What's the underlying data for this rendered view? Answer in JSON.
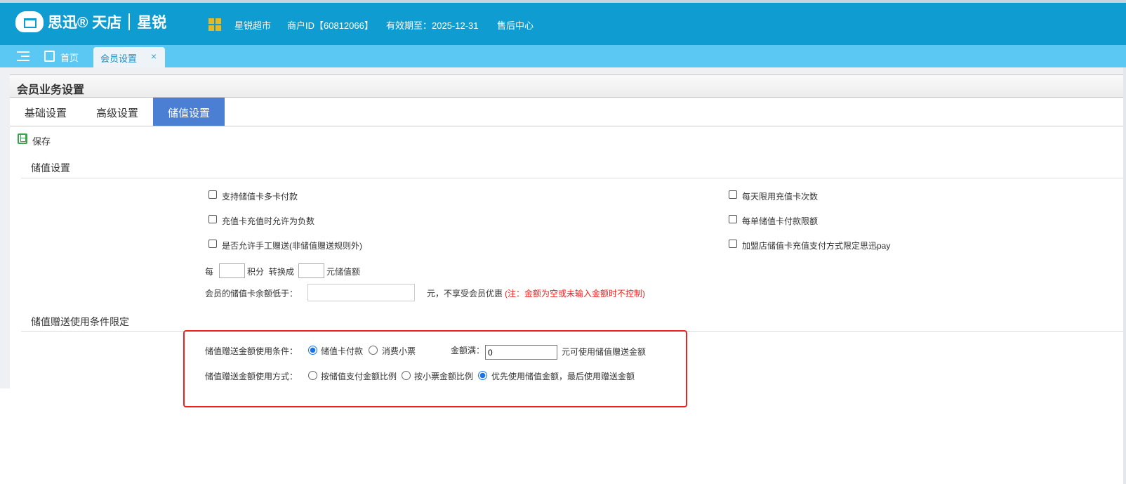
{
  "header": {
    "logo_text": "思迅® 天店",
    "product": "星锐",
    "store": "星锐超市",
    "merchant_id": "商户ID【60812066】",
    "expiry": "有效期至：2025-12-31",
    "support": "售后中心"
  },
  "tabs": {
    "home": "首页",
    "active": "会员设置",
    "close": "×"
  },
  "panel": {
    "title": "会员业务设置",
    "tabs": [
      "基础设置",
      "高级设置",
      "储值设置"
    ],
    "active_tab": "储值设置",
    "save": "保存"
  },
  "stored_value": {
    "title": "储值设置",
    "checkboxes_left": [
      {
        "label": "支持储值卡多卡付款",
        "checked": false
      },
      {
        "label": "充值卡充值时允许为负数",
        "checked": false
      },
      {
        "label": "是否允许手工赠送(非储值赠送规则外)",
        "checked": false
      }
    ],
    "checkboxes_right": [
      {
        "label": "每天限用充值卡次数",
        "checked": false
      },
      {
        "label": "每单储值卡付款限额",
        "checked": false
      },
      {
        "label": "加盟店储值卡充值支付方式限定思迅pay",
        "checked": false
      }
    ],
    "points": {
      "prefix": "每",
      "points_value": "",
      "mid1": "积分",
      "mid2": "转换成",
      "amount_value": "",
      "suffix": "元储值额"
    },
    "balance": {
      "label": "会员的储值卡余额低于：",
      "value": "",
      "suffix": "元，不享受会员优惠",
      "note": "(注：金额为空或未输入金额时不控制)"
    }
  },
  "gift": {
    "title": "储值赠送使用条件限定",
    "condition": {
      "label": "储值赠送金额使用条件：",
      "options": [
        "储值卡付款",
        "消费小票"
      ],
      "selected": "储值卡付款",
      "amount_label": "金额满：",
      "amount_value": "0",
      "amount_suffix": "元可使用储值赠送金额"
    },
    "method": {
      "label": "储值赠送金额使用方式：",
      "options": [
        "按储值支付金额比例",
        "按小票金额比例",
        "优先使用储值金额，最后使用赠送金额"
      ],
      "selected": "优先使用储值金额，最后使用赠送金额"
    }
  },
  "colors": {
    "header": "#0f9cd0",
    "tabbar": "#5bc8f4",
    "active_tab": "#4a7fd4",
    "note": "#f02020",
    "save_icon": "#3aa54a"
  }
}
